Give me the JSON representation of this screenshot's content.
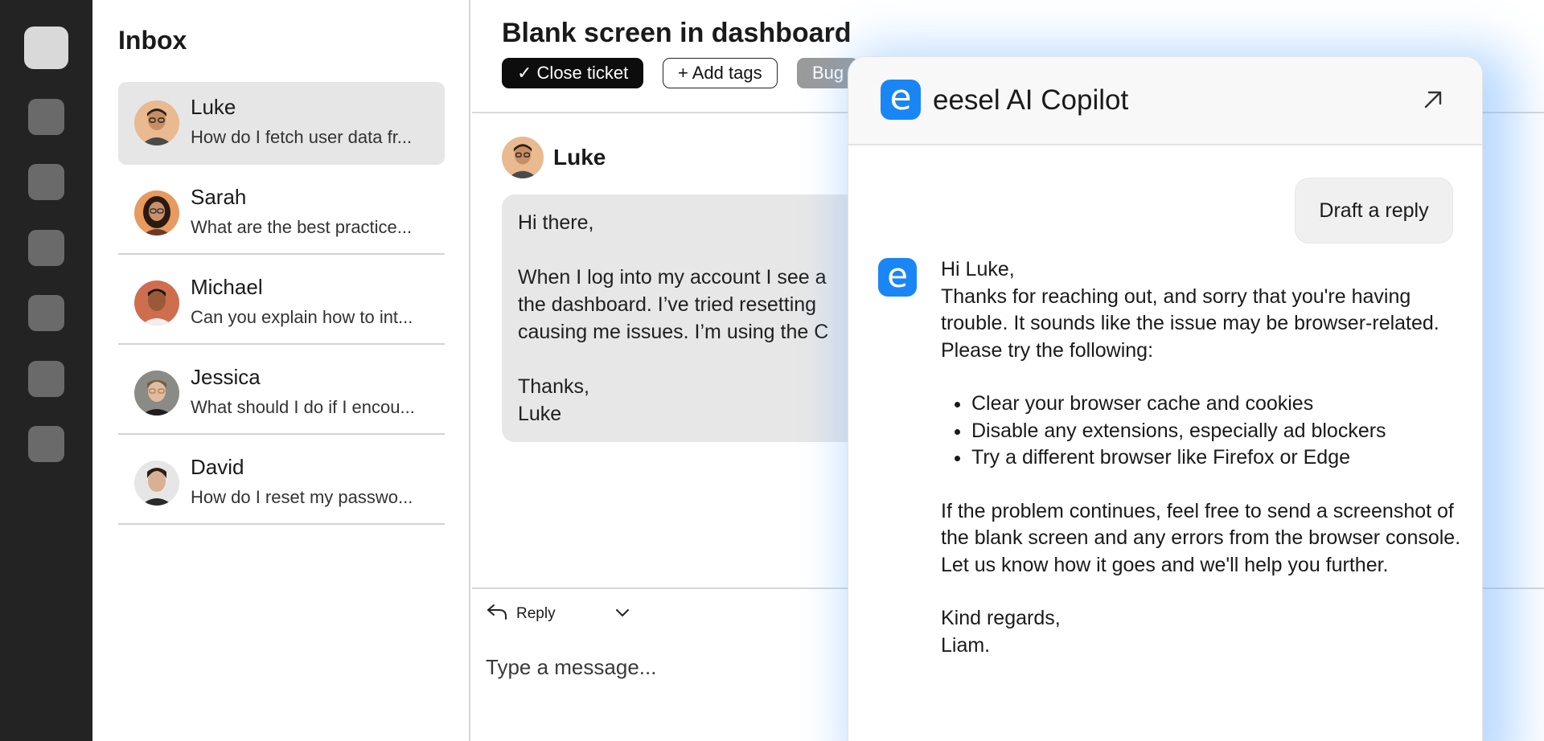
{
  "rail": {
    "items": [
      "app-home",
      "nav-2",
      "nav-3",
      "nav-4",
      "nav-5",
      "nav-6",
      "nav-7"
    ]
  },
  "inbox": {
    "title": "Inbox",
    "conversations": [
      {
        "name": "Luke",
        "preview": "How do I fetch user data fr...",
        "selected": true
      },
      {
        "name": "Sarah",
        "preview": "What are the best practice..."
      },
      {
        "name": "Michael",
        "preview": "Can you explain how to int..."
      },
      {
        "name": "Jessica",
        "preview": "What should I do if I encou..."
      },
      {
        "name": "David",
        "preview": "How do I reset my passwo..."
      }
    ]
  },
  "ticket": {
    "title": "Blank screen in dashboard",
    "close_label": "✓ Close ticket",
    "add_tags_label": "+ Add tags",
    "tag_label": "Bug",
    "author": "Luke",
    "message": {
      "greeting": "Hi there,",
      "line1": "When I log into my account I see a",
      "line2": "the dashboard. I’ve tried resetting",
      "line3": "causing me issues. I’m using the C",
      "signoff": "Thanks,",
      "signature": "Luke"
    },
    "reply_label": "Reply",
    "compose_placeholder": "Type a message..."
  },
  "copilot": {
    "logo_letter": "e",
    "title": "eesel AI Copilot",
    "draft_button": "Draft a reply",
    "reply": {
      "greeting": "Hi Luke,",
      "para1": "Thanks for reaching out, and sorry that you're having trouble. It sounds like the issue may be browser-related. Please try the following:",
      "bullets": [
        "Clear your browser cache and cookies",
        "Disable any extensions, especially ad blockers",
        "Try a different browser like Firefox or Edge"
      ],
      "para2": "If the problem continues, feel free to send a screenshot of the blank screen and any errors from the browser console. Let us know how it goes and we'll help you further.",
      "closing": "Kind regards,",
      "signature": "Liam."
    }
  },
  "colors": {
    "rail": "#232323",
    "accent": "#1a86f5",
    "selected": "#e6e6e6",
    "bubble": "#e7e7e7"
  }
}
